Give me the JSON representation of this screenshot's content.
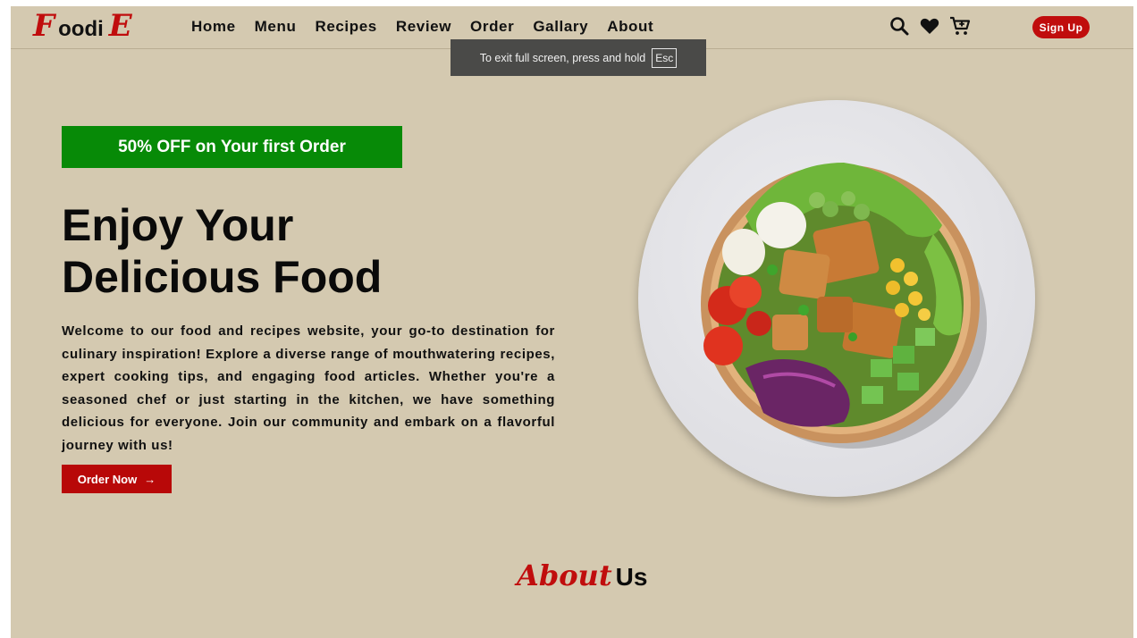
{
  "header": {
    "logo": {
      "first": "F",
      "mid": "oodi",
      "last": "E"
    },
    "nav": [
      "Home",
      "Menu",
      "Recipes",
      "Review",
      "Order",
      "Gallary",
      "About"
    ],
    "icons": [
      "search-icon",
      "heart-icon",
      "cart-icon"
    ],
    "signup_label": "Sign Up"
  },
  "fullscreen_toast": {
    "message": "To exit full screen, press and hold",
    "key": "Esc"
  },
  "hero": {
    "promo": "50% OFF on Your first Order",
    "title_line1": "Enjoy Your",
    "title_line2": "Delicious Food",
    "description": "Welcome to our food and recipes website, your go-to destination for culinary inspiration! Explore a diverse range of mouthwatering recipes, expert cooking tips, and engaging food articles. Whether you're a seasoned chef or just starting in the kitchen, we have something delicious for everyone. Join our community and embark on a flavorful journey with us!",
    "order_button": "Order Now",
    "order_arrow": "→"
  },
  "about": {
    "script": "About",
    "rest": "Us"
  },
  "colors": {
    "accent": "#c00d0d",
    "background": "#d4c9b0",
    "promo": "#078a07"
  }
}
